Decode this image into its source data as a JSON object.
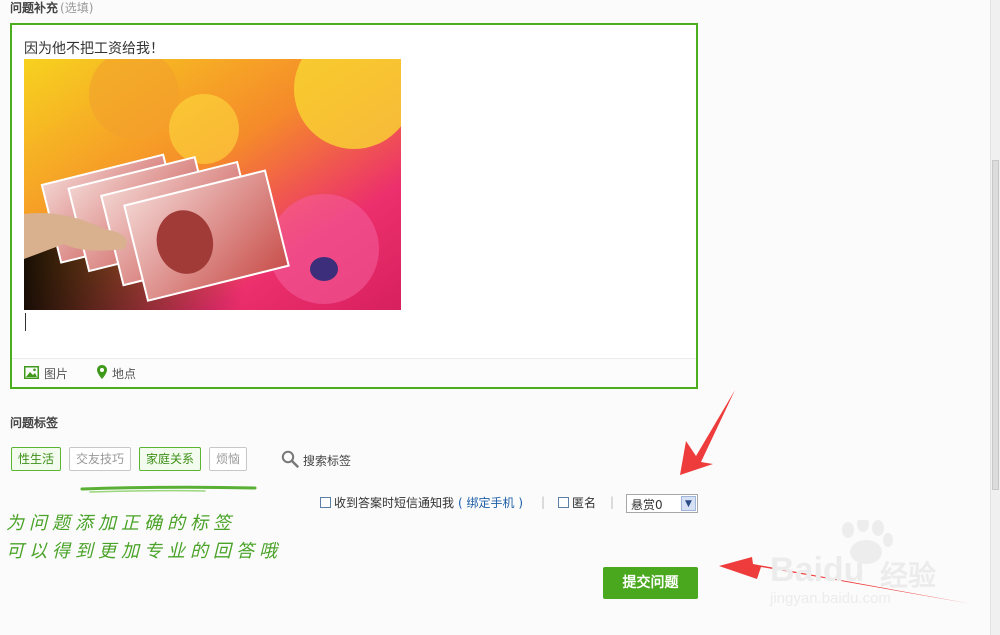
{
  "supplement": {
    "title": "问题补充",
    "optional": "(选填)"
  },
  "editor": {
    "text": "因为他不把工资给我！",
    "photo_alt": "人民币",
    "tools": {
      "image": "图片",
      "location": "地点"
    }
  },
  "tags_section": {
    "title": "问题标签",
    "tags": [
      {
        "label": "性生活",
        "selected": true
      },
      {
        "label": "交友技巧",
        "selected": false
      },
      {
        "label": "家庭关系",
        "selected": true
      },
      {
        "label": "烦恼",
        "selected": false
      }
    ],
    "search_label": "搜索标签"
  },
  "options": {
    "sms_notify": "收到答案时短信通知我",
    "bind_phone": "( 绑定手机 )",
    "anonymous": "匿名",
    "separator": "|",
    "reward": "悬赏0"
  },
  "submit_label": "提交问题",
  "annotation": {
    "line1": "为问题添加正确的标签",
    "line2": "可以得到更加专业的回答哦"
  },
  "watermark": {
    "brand": "Baidu",
    "cn": "经验",
    "url": "jingyan.baidu.com"
  },
  "colors": {
    "accent": "#49a81d",
    "border": "#4cae1f",
    "annotation": "#4aa328",
    "arrow": "#ee3b3b",
    "link": "#1f5fa8"
  }
}
